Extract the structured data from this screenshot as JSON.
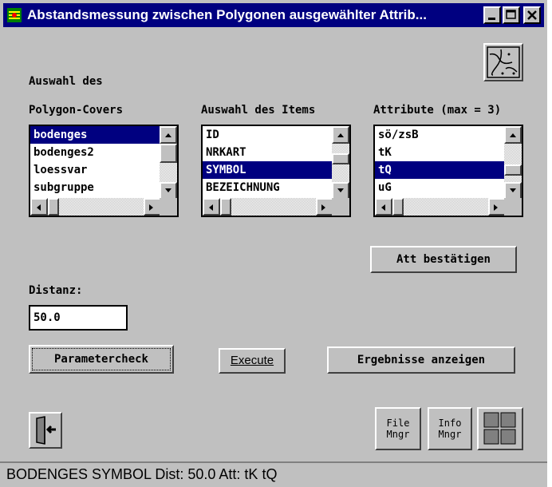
{
  "window": {
    "title": "Abstandsmessung zwischen Polygonen ausgewählter Attrib...",
    "minimize_label": "_",
    "maximize_label": "□",
    "close_label": "✕"
  },
  "labels": {
    "auswahl_des": "Auswahl des",
    "polygon_covers": "Polygon-Covers",
    "auswahl_items": "Auswahl des Items",
    "attribute": "Attribute (max = 3)",
    "distanz": "Distanz:"
  },
  "covers_list": {
    "items": [
      "bodenges",
      "bodenges2",
      "loessvar",
      "subgruppe"
    ],
    "selected_index": 0
  },
  "items_list": {
    "items": [
      "ID",
      "NRKART",
      "SYMBOL",
      "BEZEICHNUNG"
    ],
    "selected_index": 2
  },
  "attribute_list": {
    "items": [
      "sö/zsB",
      "tK",
      "tQ",
      "uG"
    ],
    "selected_index": 2
  },
  "buttons": {
    "att_bestaetigen": "Att bestätigen",
    "parametercheck": "Parametercheck",
    "execute": "Execute",
    "ergebnisse": "Ergebnisse anzeigen",
    "file_mngr_line1": "File",
    "file_mngr_line2": "Mngr",
    "info_mngr_line1": "Info",
    "info_mngr_line2": "Mngr"
  },
  "distanz_value": "50.0",
  "status_text": "BODENGES  SYMBOL Dist: 50.0  Att: tK tQ",
  "icons": {
    "app": "app-icon",
    "map": "map-icon",
    "exit": "exit-door-icon",
    "grid": "grid-icon"
  },
  "colors": {
    "selection": "#000080",
    "window_bg": "#c0c0c0",
    "titlebar": "#000080"
  }
}
